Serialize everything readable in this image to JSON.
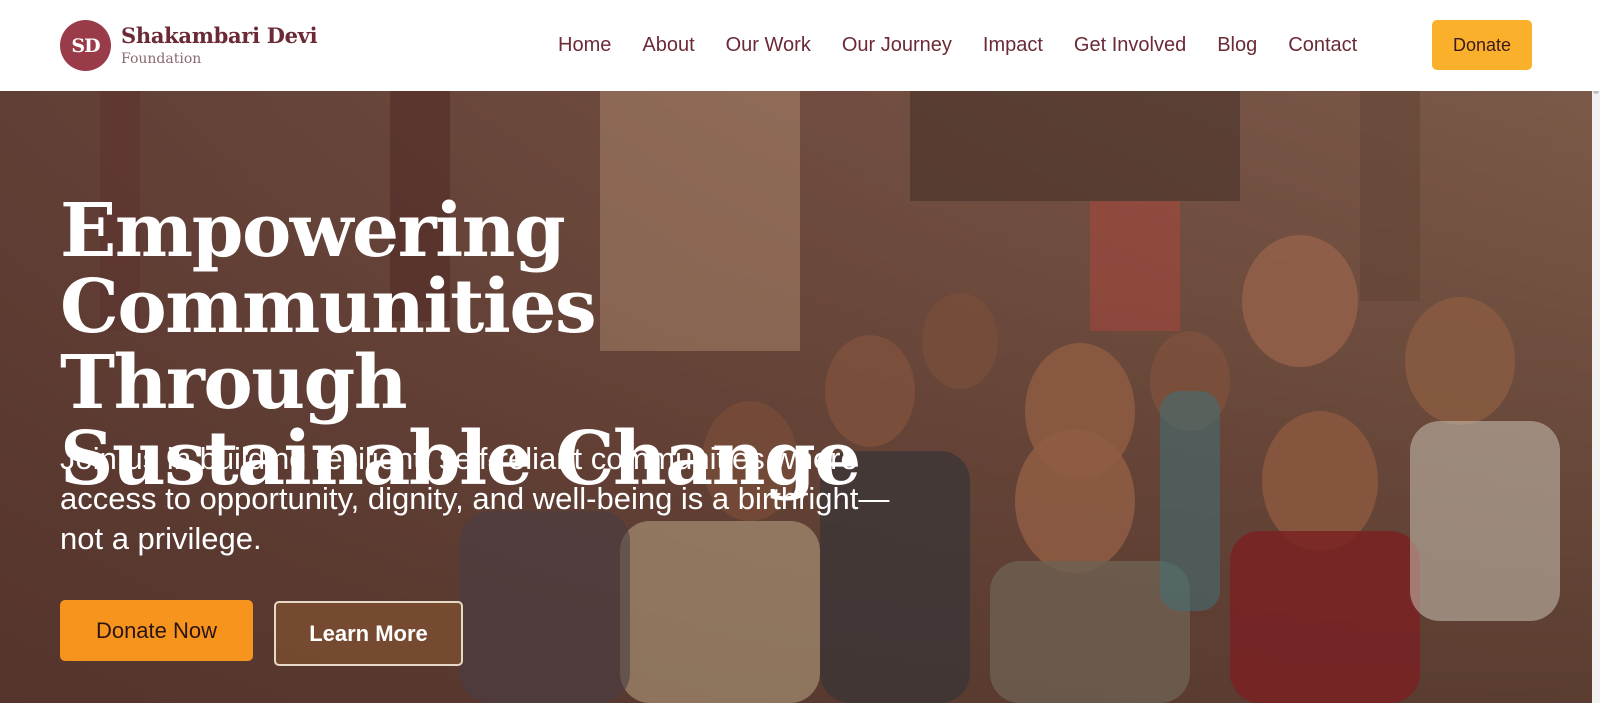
{
  "brand": {
    "logo_initials": "SD",
    "name": "Shakambari Devi",
    "subtitle": "Foundation"
  },
  "nav": {
    "items": [
      "Home",
      "About",
      "Our Work",
      "Our Journey",
      "Impact",
      "Get Involved",
      "Blog",
      "Contact"
    ],
    "donate_label": "Donate"
  },
  "hero": {
    "title_lines": [
      "Empowering",
      "Communities Through",
      "Sustainable Change"
    ],
    "subtitle": "Join us in building resilient, self-reliant communities where access to opportunity, dignity, and well-being is a birthright—not a privilege.",
    "primary_button": "Donate Now",
    "secondary_button": "Learn More",
    "background_image": "children-gathering-photo"
  },
  "colors": {
    "brand_maroon": "#6b2a36",
    "logo_bg": "#9a3b4a",
    "accent_yellow": "#fbb02b",
    "accent_orange": "#f7941d"
  }
}
